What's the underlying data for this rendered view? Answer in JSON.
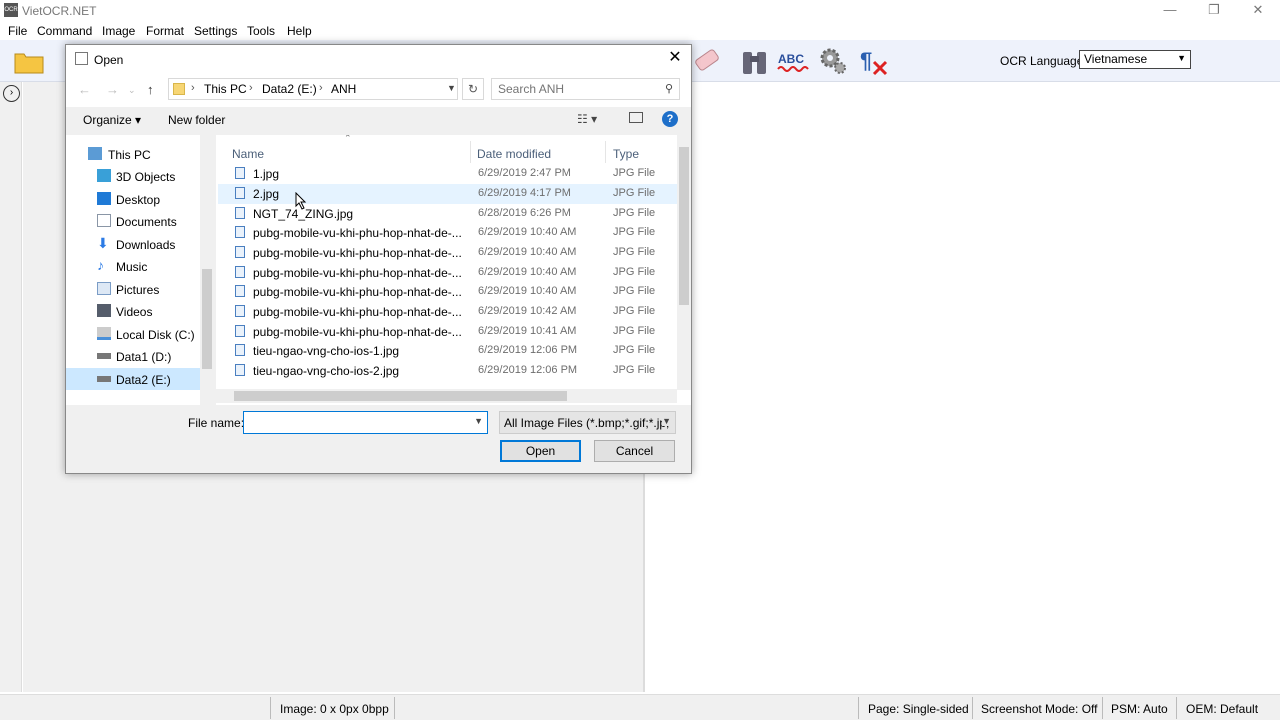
{
  "window": {
    "title": "VietOCR.NET",
    "icon_text": "OCR",
    "minimize": "—",
    "restore": "❐",
    "close": "✕"
  },
  "menu": [
    "File",
    "Command",
    "Image",
    "Format",
    "Settings",
    "Tools",
    "Help"
  ],
  "toolbar": {
    "icons": [
      "open-folder-icon",
      "scanner-icon",
      "eraser-icon",
      "binoculars-icon",
      "spellcheck-icon",
      "gear-icon",
      "pilcrow-remove-icon"
    ],
    "ocr_language_label": "OCR Language",
    "ocr_language_value": "Vietnamese"
  },
  "statusbar": {
    "image": "Image:  0 x 0px 0bpp",
    "page": "Page:  Single-sided",
    "screenshot_mode": "Screenshot Mode:  Off",
    "psm": "PSM:  Auto",
    "oem": "OEM:  Default"
  },
  "dialog": {
    "title": "Open",
    "close": "✕",
    "breadcrumb": [
      "This PC",
      "Data2 (E:)",
      "ANH"
    ],
    "search_placeholder": "Search ANH",
    "organize_label": "Organize ▾",
    "new_folder_label": "New folder",
    "help_label": "?",
    "tree": [
      {
        "label": "This PC",
        "icon": "computer-icon",
        "color": "#5b9bd5"
      },
      {
        "label": "3D Objects",
        "icon": "cube-icon",
        "color": "#39a0d8"
      },
      {
        "label": "Desktop",
        "icon": "desktop-icon",
        "color": "#1f7ad6"
      },
      {
        "label": "Documents",
        "icon": "documents-icon",
        "color": "#8a96a6"
      },
      {
        "label": "Downloads",
        "icon": "download-arrow-icon",
        "color": "#2c7be5"
      },
      {
        "label": "Music",
        "icon": "music-note-icon",
        "color": "#2c7be5"
      },
      {
        "label": "Pictures",
        "icon": "pictures-icon",
        "color": "#7a9cc6"
      },
      {
        "label": "Videos",
        "icon": "film-icon",
        "color": "#555d6b"
      },
      {
        "label": "Local Disk (C:)",
        "icon": "windows-drive-icon",
        "color": "#4a90d9"
      },
      {
        "label": "Data1 (D:)",
        "icon": "drive-icon",
        "color": "#777777"
      },
      {
        "label": "Data2 (E:)",
        "icon": "drive-icon",
        "color": "#777777"
      }
    ],
    "columns": [
      "Name",
      "Date modified",
      "Type"
    ],
    "files": [
      {
        "name": "1.jpg",
        "date": "6/29/2019 2:47 PM",
        "type": "JPG File"
      },
      {
        "name": "2.jpg",
        "date": "6/29/2019 4:17 PM",
        "type": "JPG File"
      },
      {
        "name": "NGT_74_ZING.jpg",
        "date": "6/28/2019 6:26 PM",
        "type": "JPG File"
      },
      {
        "name": "pubg-mobile-vu-khi-phu-hop-nhat-de-...",
        "date": "6/29/2019 10:40 AM",
        "type": "JPG File"
      },
      {
        "name": "pubg-mobile-vu-khi-phu-hop-nhat-de-...",
        "date": "6/29/2019 10:40 AM",
        "type": "JPG File"
      },
      {
        "name": "pubg-mobile-vu-khi-phu-hop-nhat-de-...",
        "date": "6/29/2019 10:40 AM",
        "type": "JPG File"
      },
      {
        "name": "pubg-mobile-vu-khi-phu-hop-nhat-de-...",
        "date": "6/29/2019 10:40 AM",
        "type": "JPG File"
      },
      {
        "name": "pubg-mobile-vu-khi-phu-hop-nhat-de-...",
        "date": "6/29/2019 10:42 AM",
        "type": "JPG File"
      },
      {
        "name": "pubg-mobile-vu-khi-phu-hop-nhat-de-...",
        "date": "6/29/2019 10:41 AM",
        "type": "JPG File"
      },
      {
        "name": "tieu-ngao-vng-cho-ios-1.jpg",
        "date": "6/29/2019 12:06 PM",
        "type": "JPG File"
      },
      {
        "name": "tieu-ngao-vng-cho-ios-2.jpg",
        "date": "6/29/2019 12:06 PM",
        "type": "JPG File"
      }
    ],
    "file_name_label": "File name:",
    "file_name_value": "",
    "file_type_value": "All Image Files (*.bmp;*.gif;*.jp;",
    "open_label": "Open",
    "cancel_label": "Cancel"
  }
}
